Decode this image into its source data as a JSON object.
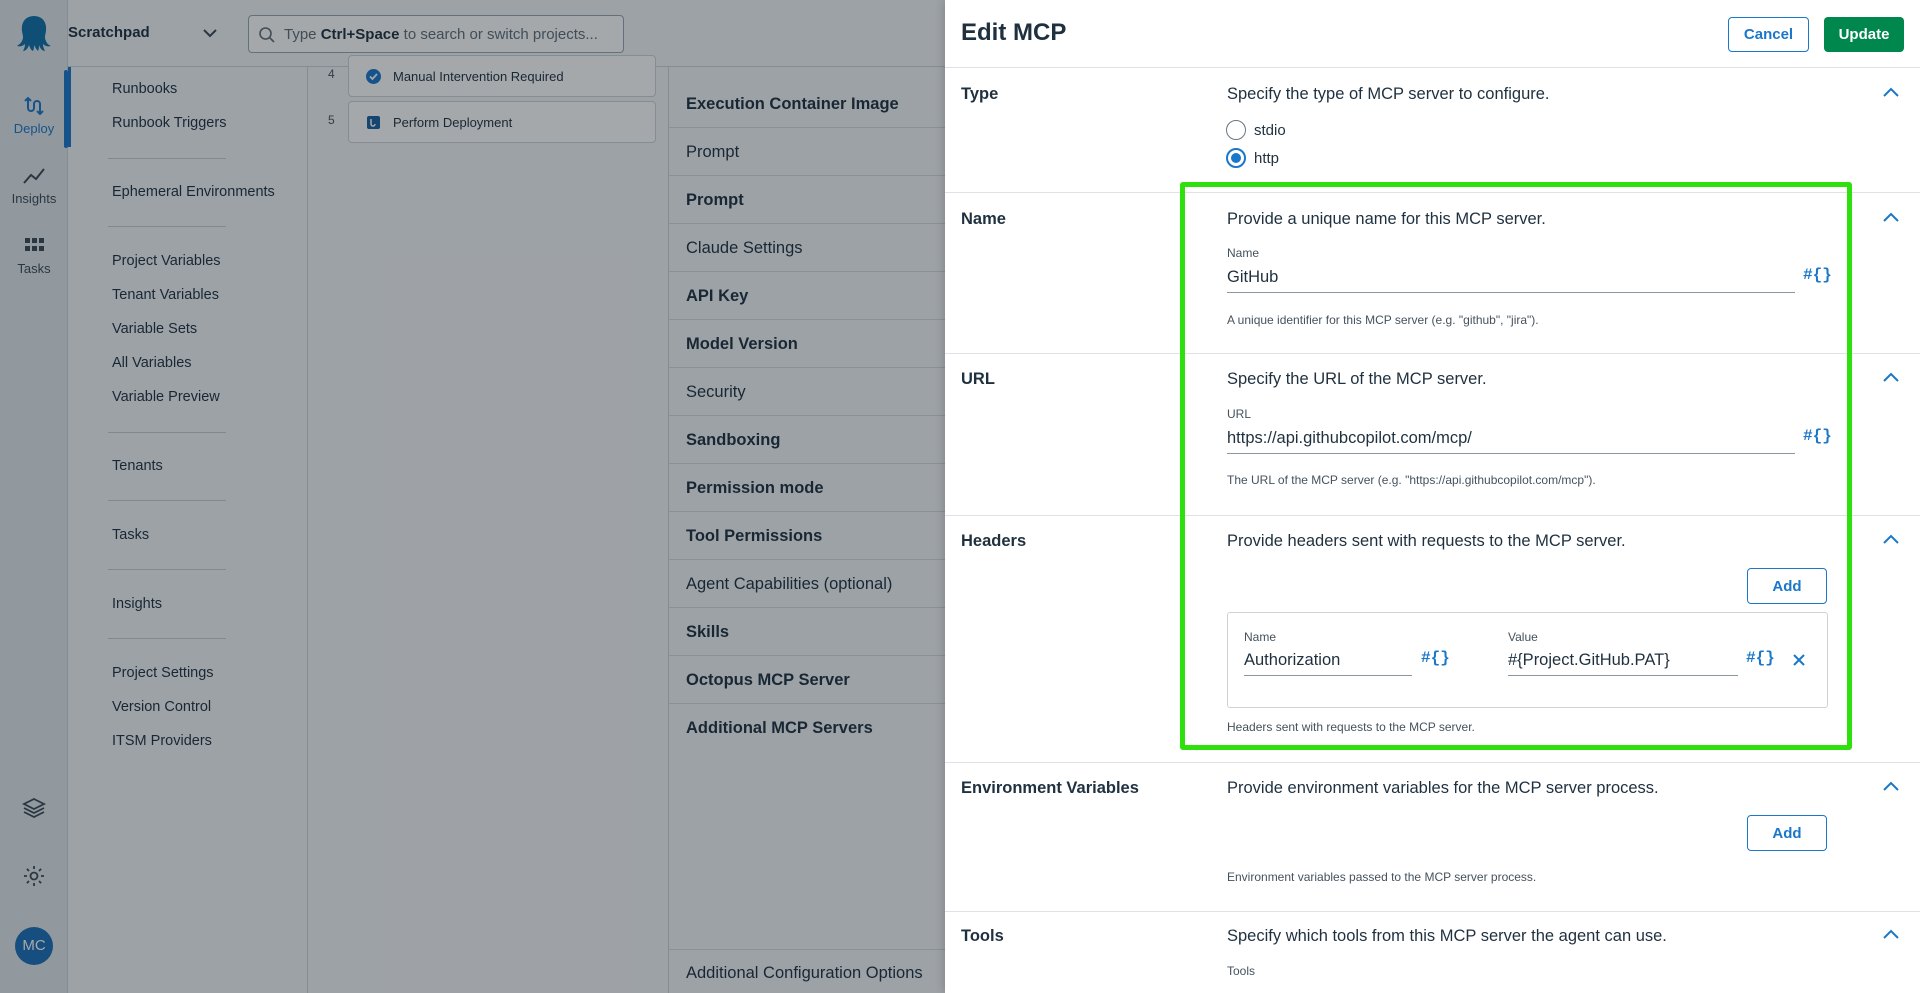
{
  "rail": {
    "items": [
      {
        "label": "Deploy",
        "icon": "deploy-icon"
      },
      {
        "label": "Insights",
        "icon": "insights-icon"
      },
      {
        "label": "Tasks",
        "icon": "tasks-icon"
      }
    ],
    "avatar": "MC",
    "bottom_icons": [
      "layers-icon",
      "gear-icon"
    ]
  },
  "topbar": {
    "project": "Scratchpad",
    "search_prefix": "Type ",
    "search_shortcut": "Ctrl+Space",
    "search_suffix": " to search or switch projects..."
  },
  "sidenav": {
    "items": [
      "Runbooks",
      "Runbook Triggers",
      "Ephemeral Environments",
      "Project Variables",
      "Tenant Variables",
      "Variable Sets",
      "All Variables",
      "Variable Preview",
      "Tenants",
      "Tasks",
      "Insights",
      "Project Settings",
      "Version Control",
      "ITSM Providers"
    ]
  },
  "steps": [
    {
      "num": "4",
      "label": "Manual Intervention Required",
      "icon": "check-circle-icon"
    },
    {
      "num": "5",
      "label": "Perform Deployment",
      "icon": "deploy-step-icon"
    }
  ],
  "mid_sections": [
    "Execution Container Image",
    "Prompt",
    "Prompt",
    "Claude Settings",
    "API Key",
    "Model Version",
    "Security",
    "Sandboxing",
    "Permission mode",
    "Tool Permissions",
    "Agent Capabilities (optional)",
    "Skills",
    "Octopus MCP Server",
    "Additional MCP Servers"
  ],
  "mid_footer": "Additional Configuration Options",
  "drawer": {
    "title": "Edit MCP",
    "cancel": "Cancel",
    "update": "Update",
    "type": {
      "title": "Type",
      "desc": "Specify the type of MCP server to configure.",
      "options": [
        "stdio",
        "http"
      ],
      "selected": "http"
    },
    "name": {
      "title": "Name",
      "desc": "Provide a unique name for this MCP server.",
      "label": "Name",
      "value": "GitHub",
      "help": "A unique identifier for this MCP server (e.g. \"github\", \"jira\")."
    },
    "url": {
      "title": "URL",
      "desc": "Specify the URL of the MCP server.",
      "label": "URL",
      "value": "https://api.githubcopilot.com/mcp/",
      "help": "The URL of the MCP server (e.g. \"https://api.githubcopilot.com/mcp\")."
    },
    "headers": {
      "title": "Headers",
      "desc": "Provide headers sent with requests to the MCP server.",
      "add": "Add",
      "name_label": "Name",
      "name_value": "Authorization",
      "value_label": "Value",
      "value_value": "#{Project.GitHub.PAT}",
      "help": "Headers sent with requests to the MCP server."
    },
    "env": {
      "title": "Environment Variables",
      "desc": "Provide environment variables for the MCP server process.",
      "add": "Add",
      "help": "Environment variables passed to the MCP server process."
    },
    "tools": {
      "title": "Tools",
      "desc": "Specify which tools from this MCP server the agent can use.",
      "label": "Tools"
    },
    "hash_symbol": "#{}"
  },
  "colors": {
    "accent": "#1a77ca",
    "update_button": "#00874d",
    "highlight": "#2ee10c"
  }
}
